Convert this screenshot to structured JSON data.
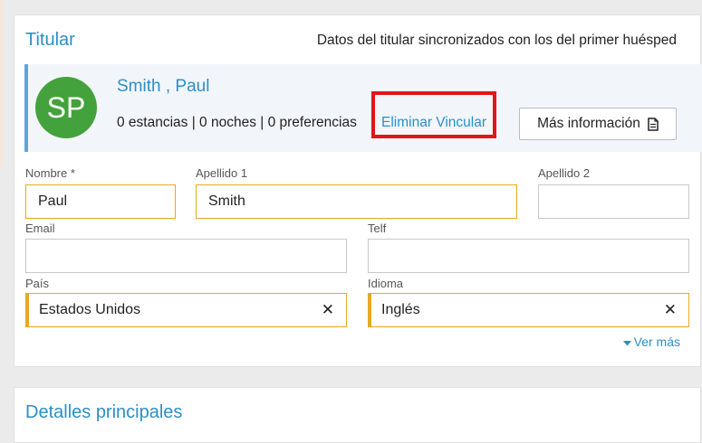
{
  "holder": {
    "title": "Titular",
    "sync_note": "Datos del titular sincronizados con los del primer huésped"
  },
  "guest": {
    "initials": "SP",
    "name": "Smith , Paul",
    "stats": "0 estancias | 0 noches | 0 preferencias",
    "unlink_label": "Eliminar Vincular",
    "more_info_label": "Más información",
    "avatar_color": "#44a23c",
    "highlight_color": "#e0161b"
  },
  "form": {
    "first_name": {
      "label": "Nombre *",
      "value": "Paul"
    },
    "last_name1": {
      "label": "Apellido 1",
      "value": "Smith"
    },
    "last_name2": {
      "label": "Apellido 2",
      "value": ""
    },
    "email": {
      "label": "Email",
      "value": ""
    },
    "phone": {
      "label": "Telf",
      "value": ""
    },
    "country": {
      "label": "País",
      "value": "Estados Unidos"
    },
    "language": {
      "label": "Idioma",
      "value": "Inglés"
    },
    "clear_symbol": "✕",
    "see_more_label": "Ver más"
  },
  "next_section": {
    "title": "Detalles principales"
  },
  "colors": {
    "accent": "#2a8fc8",
    "required_border": "#e8a825",
    "panel_border": "#5ca6e0"
  }
}
